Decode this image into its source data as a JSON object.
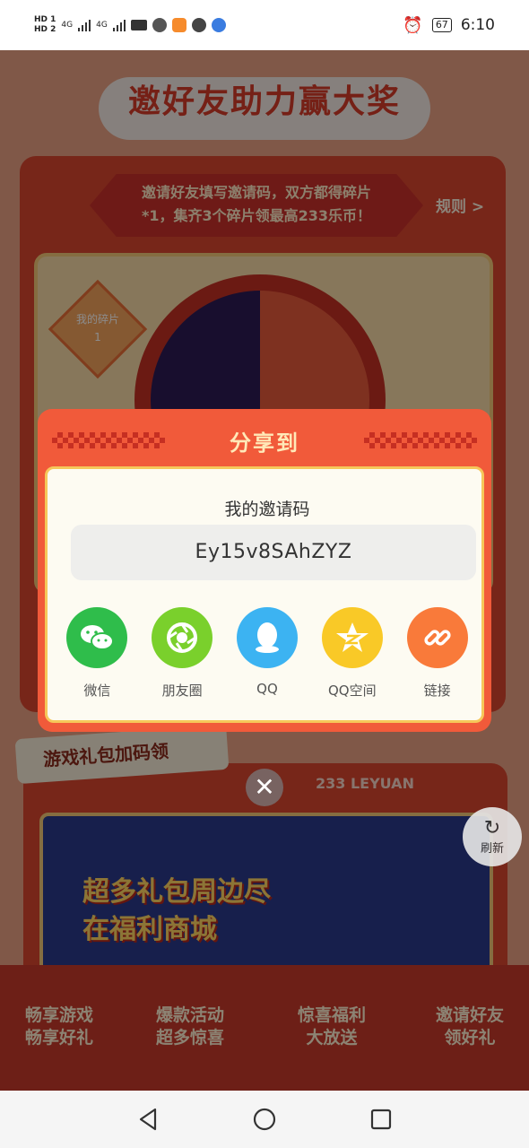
{
  "status_bar": {
    "hd1": "HD 1",
    "hd2": "HD 2",
    "net1": "4G",
    "net2": "4G",
    "battery": "67",
    "time": "6:10"
  },
  "app": {
    "banner_title": "邀好友助力赢大奖",
    "invite_desc_line1": "邀请好友填写邀请码，双方都得碎片",
    "invite_desc_line2": "*1，集齐3个碎片领最高233乐币！",
    "rules_link": "规则 >",
    "fragments_label": "我的碎片",
    "fragments_count": "1",
    "gift_section_title": "游戏礼包加码领",
    "leyuan_text": "233 LEYUAN",
    "promo_title": "超多礼包周边尽在福利商城",
    "refresh_label": "刷新",
    "bottom_nav": [
      {
        "line1": "畅享游戏",
        "line2": "畅享好礼"
      },
      {
        "line1": "爆款活动",
        "line2": "超多惊喜"
      },
      {
        "line1": "惊喜福利",
        "line2": "大放送"
      },
      {
        "line1": "邀请好友",
        "line2": "领好礼"
      }
    ]
  },
  "modal": {
    "title": "分享到",
    "code_label": "我的邀请码",
    "invite_code": "Ey15v8SAhZYZ",
    "share_targets": [
      {
        "label": "微信",
        "icon": "wechat-icon",
        "color": "#2fbd4b"
      },
      {
        "label": "朋友圈",
        "icon": "moments-icon",
        "color": "#7ad02c"
      },
      {
        "label": "QQ",
        "icon": "qq-icon",
        "color": "#3cb3f2"
      },
      {
        "label": "QQ空间",
        "icon": "qzone-icon",
        "color": "#f9c927"
      },
      {
        "label": "链接",
        "icon": "link-icon",
        "color": "#f97a3a"
      }
    ],
    "close": "✕"
  }
}
